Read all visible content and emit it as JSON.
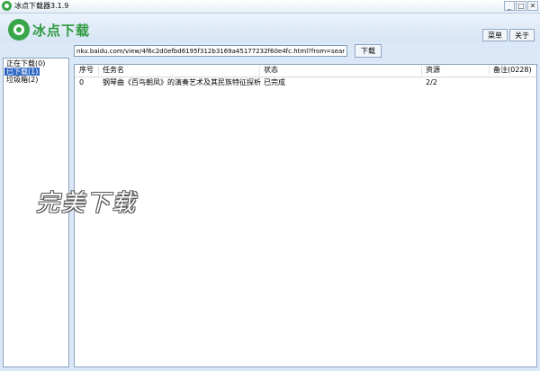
{
  "window": {
    "title": "冰点下载器3.1.9",
    "controls": {
      "minimize": "_",
      "maximize": "□",
      "close": "✕"
    }
  },
  "header": {
    "logo_text": "冰点下载",
    "menu_label": "菜单",
    "about_label": "关于"
  },
  "url_bar": {
    "value": "nku.baidu.com/view/4f6c2d0efbd6195f312b3169a45177232f60e4fc.html?from=search",
    "download_label": "下载"
  },
  "sidebar": {
    "items": [
      {
        "label": "正在下载(0)",
        "selected": false
      },
      {
        "label": "已下载(1)",
        "selected": true
      },
      {
        "label": "垃圾箱(2)",
        "selected": false
      }
    ]
  },
  "list": {
    "columns": {
      "index": "序号",
      "task": "任务名",
      "status": "状态",
      "resource": "资源",
      "note": "备注(0228)"
    },
    "rows": [
      {
        "index": "0",
        "task": "钢琴曲《百鸟朝凤》的演奏艺术及其民族特征探析",
        "status": "已完成",
        "resource": "2/2",
        "note": ""
      }
    ]
  },
  "watermark": "完美下载"
}
